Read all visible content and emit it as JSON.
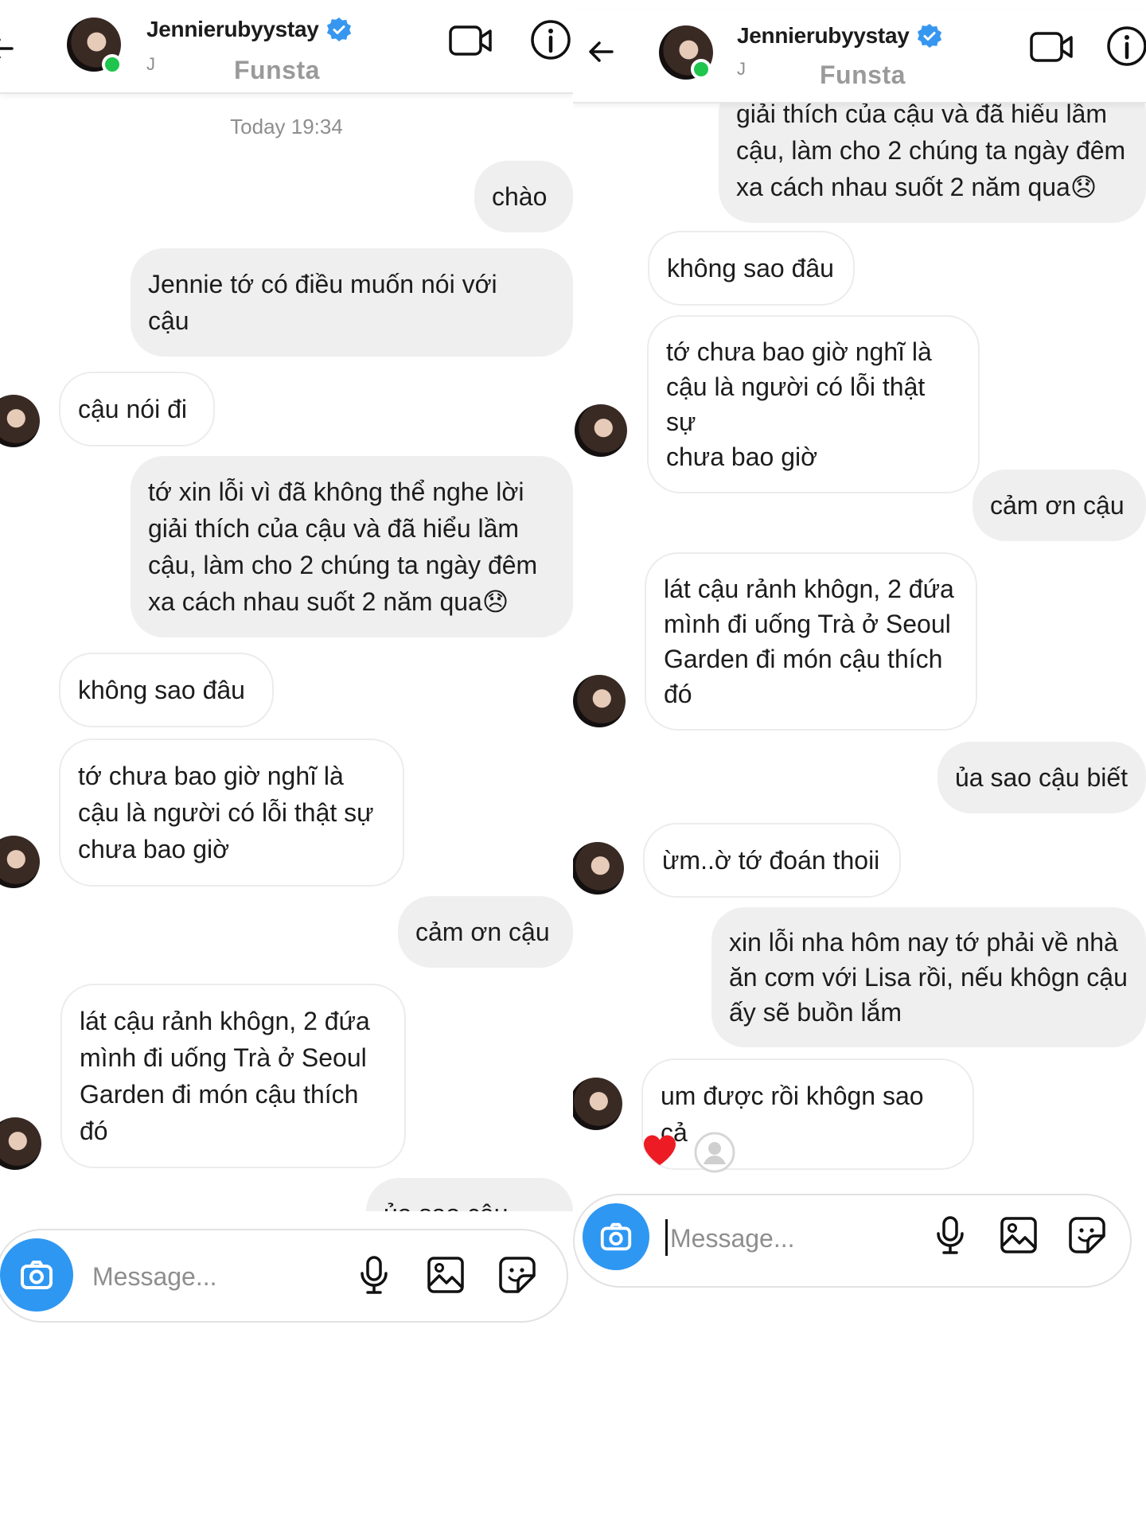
{
  "contact": {
    "name": "Jennierubyystay",
    "subname": "J",
    "account_label": "Funsta",
    "verified": true,
    "online": true
  },
  "colors": {
    "accent_blue": "#3797f0",
    "online_green": "#1fc54d",
    "outgoing_bubble": "#efefef",
    "heart_red": "#ed1c24"
  },
  "icons": {
    "back": "arrow-left-icon",
    "video": "video-camera-icon",
    "info": "info-icon",
    "camera": "camera-icon",
    "mic": "microphone-icon",
    "gallery": "image-icon",
    "sticker": "sticker-icon"
  },
  "left_panel": {
    "timestamp": "Today 19:34",
    "messages": [
      {
        "from": "me",
        "text": "chào"
      },
      {
        "from": "me",
        "text": "Jennie tớ có điều muốn nói với\ncậu"
      },
      {
        "from": "them",
        "text": "cậu nói đi"
      },
      {
        "from": "me",
        "text": "tớ xin lỗi vì đã không thể nghe lời\ngiải thích của cậu và đã hiểu lầm\ncậu, làm cho 2 chúng ta ngày đêm\nxa cách nhau suốt 2 năm qua😞"
      },
      {
        "from": "them",
        "text": "không sao đâu"
      },
      {
        "from": "them",
        "text": "tớ chưa bao giờ nghĩ là\ncậu là người có lỗi thật sự\nchưa bao giờ"
      },
      {
        "from": "me",
        "text": "cảm ơn cậu"
      },
      {
        "from": "them",
        "text": "lát cậu rảnh khôgn, 2 đứa\nmình đi uống Trà ở Seoul\nGarden đi món cậu thích\nđó"
      },
      {
        "from": "me",
        "text": "ủa sao cậu biết"
      }
    ],
    "composer_placeholder": "Message..."
  },
  "right_panel": {
    "messages": [
      {
        "from": "me",
        "text": "giải thích của cậu và đã hiểu lầm\ncậu, làm cho 2 chúng ta ngày đêm\nxa cách nhau suốt 2 năm qua😞"
      },
      {
        "from": "them",
        "text": "không sao đâu"
      },
      {
        "from": "them",
        "text": "tớ chưa bao giờ nghĩ là\ncậu là người có lỗi thật sự\nchưa bao giờ"
      },
      {
        "from": "me",
        "text": "cảm ơn cậu"
      },
      {
        "from": "them",
        "text": "lát cậu rảnh khôgn, 2 đứa\nmình đi uống Trà ở Seoul\nGarden đi món cậu thích\nđó"
      },
      {
        "from": "me",
        "text": "ủa sao cậu biết"
      },
      {
        "from": "them",
        "text": "ừm..ờ tớ đoán thoii"
      },
      {
        "from": "me",
        "text": "xin lỗi nha hôm nay tớ phải về nhà\năn cơm với Lisa rồi, nếu khôgn cậu\nấy sẽ buồn lắm"
      },
      {
        "from": "them",
        "text": "um được rồi khôgn sao cả"
      }
    ],
    "reaction": "heart",
    "composer_placeholder": "Message..."
  }
}
